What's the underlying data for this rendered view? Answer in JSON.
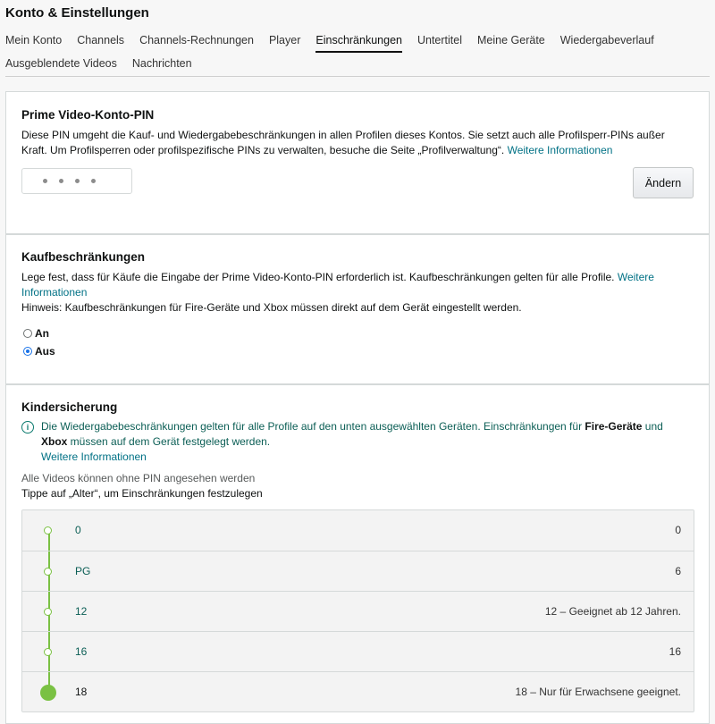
{
  "page": {
    "title": "Konto & Einstellungen"
  },
  "tabs": {
    "row1": [
      "Mein Konto",
      "Channels",
      "Channels-Rechnungen",
      "Player",
      "Einschränkungen",
      "Untertitel",
      "Meine Geräte",
      "Wiedergabeverlauf"
    ],
    "row2": [
      "Ausgeblendete Videos",
      "Nachrichten"
    ],
    "active": "Einschränkungen"
  },
  "pin_section": {
    "title": "Prime Video-Konto-PIN",
    "description": "Diese PIN umgeht die Kauf- und Wiedergabebeschränkungen in allen Profilen dieses Kontos. Sie setzt auch alle Profilsperr-PINs außer Kraft. Um Profilsperren oder profilspezifische PINs zu verwalten, besuche die Seite „Profilverwaltung“.",
    "link": "Weitere Informationen",
    "pin_dots": 4,
    "change_button": "Ändern"
  },
  "purchase_section": {
    "title": "Kaufbeschränkungen",
    "description": "Lege fest, dass für Käufe die Eingabe der Prime Video-Konto-PIN erforderlich ist. Kaufbeschränkungen gelten für alle Profile.",
    "link": "Weitere Informationen",
    "note": "Hinweis: Kaufbeschränkungen für Fire-Geräte und Xbox müssen direkt auf dem Gerät eingestellt werden.",
    "option_on": "An",
    "option_off": "Aus",
    "selected": "Aus"
  },
  "parental_section": {
    "title": "Kindersicherung",
    "info_part1": "Die Wiedergabebeschränkungen gelten für alle Profile auf den unten ausgewählten Geräten. Einschränkungen für ",
    "info_bold1": "Fire-Geräte",
    "info_part2": " und ",
    "info_bold2": "Xbox",
    "info_part3": " müssen auf dem Gerät festgelegt werden.",
    "info_link": "Weitere Informationen",
    "status": "Alle Videos können ohne PIN angesehen werden",
    "instruction": "Tippe auf „Alter“, um Einschränkungen festzulegen",
    "ratings": [
      {
        "label": "0",
        "description": "0"
      },
      {
        "label": "PG",
        "description": "6"
      },
      {
        "label": "12",
        "description": "12 – Geeignet ab 12 Jahren."
      },
      {
        "label": "16",
        "description": "16"
      },
      {
        "label": "18",
        "description": "18 – Nur für Erwachsene geeignet."
      }
    ],
    "selected_rating": "18"
  },
  "colors": {
    "link": "#007185",
    "rail": "#7ac143",
    "info": "#0b7a6e"
  },
  "icons": {
    "info": "info-circle-icon"
  }
}
